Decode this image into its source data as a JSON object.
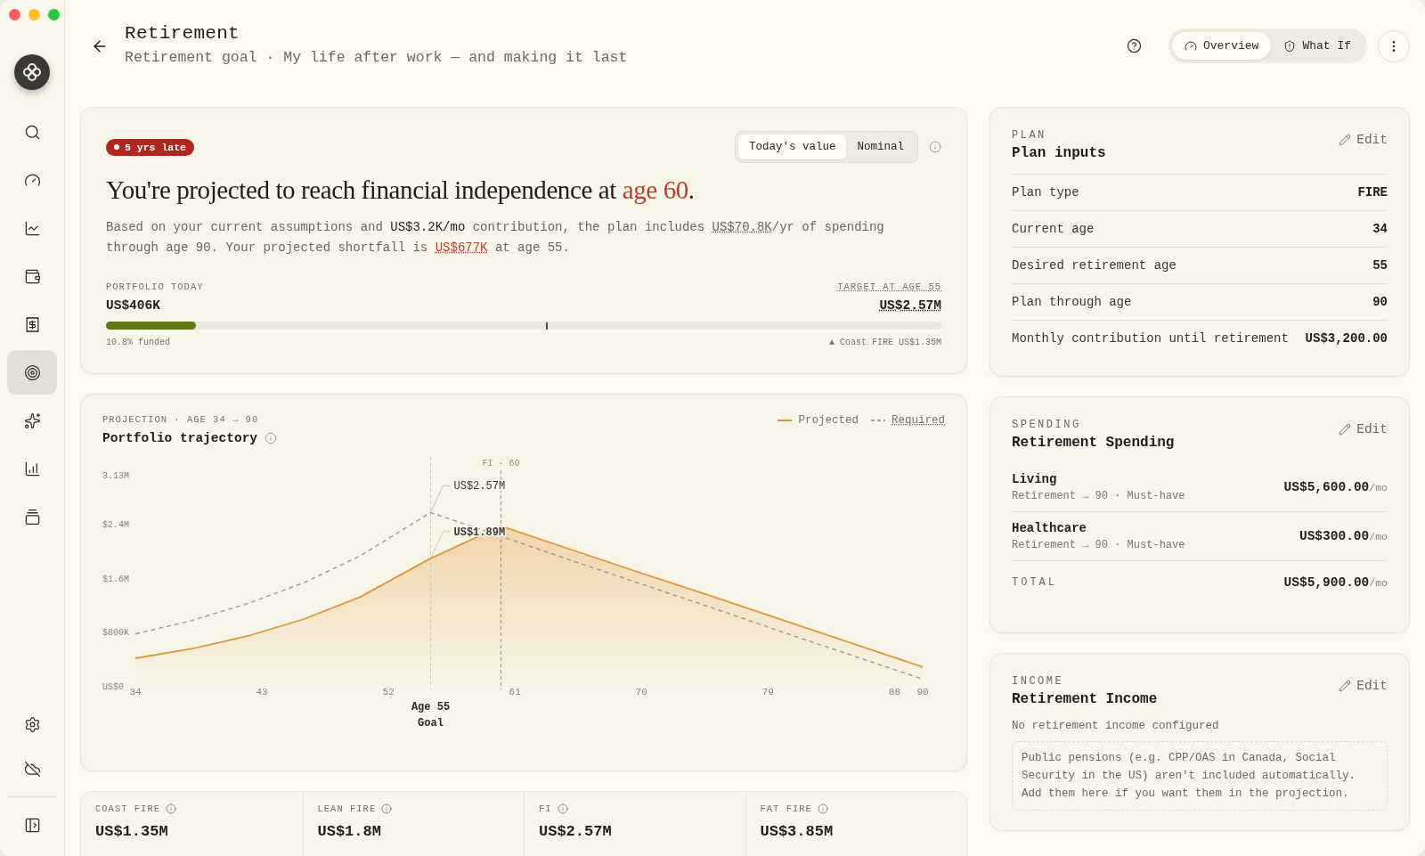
{
  "sidebar": {
    "items": [
      {
        "selected": false
      },
      {
        "selected": false
      },
      {
        "selected": false
      },
      {
        "selected": false
      },
      {
        "selected": false
      },
      {
        "selected": true
      },
      {
        "selected": false
      },
      {
        "selected": false
      },
      {
        "selected": false
      }
    ]
  },
  "header": {
    "title": "Retirement",
    "subtitle": "Retirement goal · My life after work — and making it last",
    "views": [
      {
        "label": "Overview",
        "selected": true
      },
      {
        "label": "What If",
        "selected": false
      }
    ]
  },
  "summary": {
    "badge": "5 yrs late",
    "value_modes": [
      {
        "label": "Today's value",
        "selected": true
      },
      {
        "label": "Nominal",
        "selected": false
      }
    ],
    "headline": [
      {
        "kind": "plain",
        "text": "You're projected to reach financial independence at "
      },
      {
        "kind": "alert",
        "text": "age 60"
      },
      {
        "kind": "plain",
        "text": "."
      }
    ],
    "body": [
      {
        "kind": "plain",
        "text": "Based on your current assumptions and "
      },
      {
        "kind": "strong",
        "text": "US$3.2K/mo"
      },
      {
        "kind": "plain",
        "text": " contribution, the plan includes "
      },
      {
        "kind": "dotted",
        "text": "US$70.8K"
      },
      {
        "kind": "plain",
        "text": "/yr of spending through age 90. Your projected shortfall is "
      },
      {
        "kind": "alert",
        "text": "US$677K"
      },
      {
        "kind": "plain",
        "text": " at age 55."
      }
    ],
    "portfolio_label": "PORTFOLIO TODAY",
    "portfolio_value": "US$406K",
    "target_label": "TARGET AT AGE 55",
    "target_value": "US$2.57M",
    "progress": {
      "level": 0.108
    },
    "marker": {
      "level": 0.527
    },
    "funded": "10.8% funded",
    "marker_note": "▲ Coast FIRE US$1.35M"
  },
  "projection": {
    "eyebrow": "PROJECTION · AGE 34 → 90",
    "title": "Portfolio trajectory",
    "chart_data": {
      "type": "line",
      "x": [
        34,
        38,
        42,
        46,
        50,
        55,
        60,
        65,
        70,
        75,
        80,
        85,
        90
      ],
      "series": [
        {
          "name": "Projected",
          "color": "#e0973a",
          "type": "area",
          "line_style": "solid",
          "values": [
            410000,
            550000,
            740000,
            990000,
            1320000,
            1890000,
            2370000,
            2020000,
            1670000,
            1330000,
            980000,
            630000,
            280000
          ]
        },
        {
          "name": "Required",
          "color": "#a09c90",
          "type": "line",
          "line_style": "dashed",
          "values": [
            770000,
            970000,
            1220000,
            1530000,
            1930000,
            2570000,
            2220000,
            1860000,
            1510000,
            1160000,
            800000,
            450000,
            100000
          ]
        }
      ],
      "xlim": [
        34,
        90
      ],
      "ylim": [
        0,
        3130000
      ],
      "xticks": [
        34,
        43,
        52,
        61,
        70,
        79,
        88,
        90
      ],
      "yticks": [
        {
          "value": 0,
          "label": "US$0"
        },
        {
          "value": 800000,
          "label": "$800K"
        },
        {
          "value": 1600000,
          "label": "$1.6M"
        },
        {
          "value": 2400000,
          "label": "$2.4M"
        },
        {
          "value": 3130000,
          "label": "3.13M"
        }
      ],
      "ref_lines": [
        {
          "axis": "x",
          "value": 55,
          "label": "Age 55"
        },
        {
          "axis": "x",
          "value": 60,
          "label": "FI · 60"
        }
      ],
      "annotations": [
        "Goal",
        {
          "text": "US$2.57M",
          "x": 55,
          "y": 2570000
        },
        {
          "text": "US$1.89M",
          "x": 55,
          "y": 1890000
        }
      ]
    }
  },
  "stats": [
    {
      "label": "COAST FIRE",
      "value": "US$1.35M"
    },
    {
      "label": "LEAN FIRE",
      "value": "US$1.8M"
    },
    {
      "label": "FI",
      "value": "US$2.57M"
    },
    {
      "label": "FAT FIRE",
      "value": "US$3.85M"
    }
  ],
  "plan": {
    "eyebrow": "PLAN",
    "title": "Plan inputs",
    "action": "Edit",
    "rows": [
      {
        "label": "Plan type",
        "value": "FIRE"
      },
      {
        "label": "Current age",
        "value": "34"
      },
      {
        "label": "Desired retirement age",
        "value": "55"
      },
      {
        "label": "Plan through age",
        "value": "90"
      },
      {
        "label": "Monthly contribution until retirement",
        "value": "US$3,200.00"
      }
    ]
  },
  "spending": {
    "eyebrow": "SPENDING",
    "title": "Retirement Spending",
    "action": "Edit",
    "items": [
      {
        "name": "Living",
        "detail": "Retirement → 90 · Must-have",
        "amount": "US$5,600.00",
        "unit": "/mo"
      },
      {
        "name": "Healthcare",
        "detail": "Retirement → 90 · Must-have",
        "amount": "US$300.00",
        "unit": "/mo"
      }
    ],
    "total": {
      "label": "TOTAL",
      "amount": "US$5,900.00",
      "unit": "/mo"
    }
  },
  "income": {
    "eyebrow": "INCOME",
    "title": "Retirement Income",
    "action": "Edit",
    "empty": "No retirement income configured",
    "note": "Public pensions (e.g. CPP/OAS in Canada, Social Security in the US) aren't included automatically. Add them here if you want them in the projection."
  }
}
